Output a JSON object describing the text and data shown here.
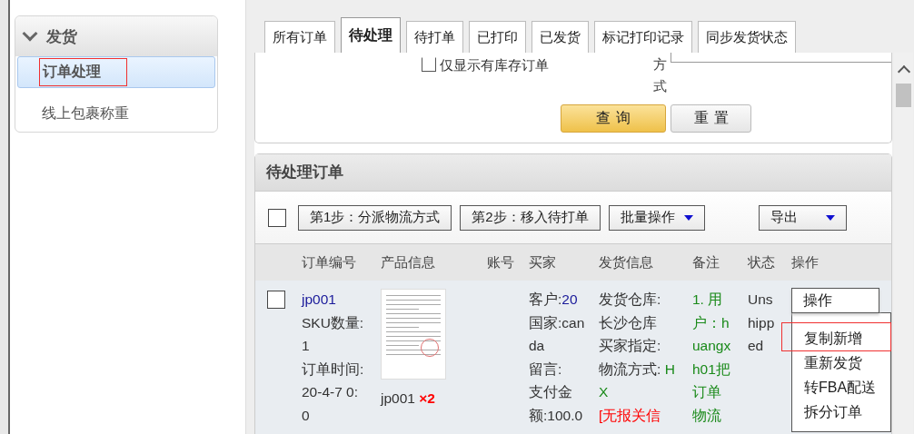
{
  "sidebar": {
    "title": "发货",
    "expanded": true,
    "items": [
      {
        "label": "订单处理",
        "selected": true,
        "highlighted": true
      },
      {
        "label": "线上包裹称重",
        "selected": false,
        "highlighted": false
      }
    ]
  },
  "tabs": [
    {
      "label": "所有订单",
      "selected": false
    },
    {
      "label": "待处理",
      "selected": true
    },
    {
      "label": "待打单",
      "selected": false
    },
    {
      "label": "已打印",
      "selected": false
    },
    {
      "label": "已发货",
      "selected": false
    },
    {
      "label": "标记打印记录",
      "selected": false
    },
    {
      "label": "同步发货状态",
      "selected": false
    }
  ],
  "filter": {
    "stock_only": {
      "label": "仅显示有库存订单",
      "checked": false
    },
    "select_label": "方式",
    "buttons": [
      {
        "label": "查询",
        "kind": "primary"
      },
      {
        "label": "重置",
        "kind": "default"
      }
    ]
  },
  "orders": {
    "title": "待处理订单",
    "select_all": false,
    "toolbar": [
      {
        "label": "第1步：分派物流方式",
        "kind": "button"
      },
      {
        "label": "第2步：移入待打单",
        "kind": "button"
      },
      {
        "label": "批量操作",
        "kind": "dropdown"
      },
      {
        "label": "导出",
        "kind": "dropdown"
      }
    ],
    "columns": [
      "订单编号",
      "产品信息",
      "账号",
      "买家",
      "发货信息",
      "备注",
      "状态",
      "操作"
    ],
    "rows": [
      {
        "selected": false,
        "order": [
          [
            {
              "text": "jp001",
              "kind": "link"
            }
          ],
          [
            {
              "text": "SKU数量:"
            }
          ],
          [
            {
              "text": "1"
            }
          ],
          [
            {
              "text": "订单时间:"
            }
          ],
          [
            {
              "text": "20-4-7 0:"
            }
          ],
          [
            {
              "text": "0"
            }
          ]
        ],
        "product": {
          "name": "jp001",
          "quantity": "×2"
        },
        "buyer": [
          [
            {
              "text": "客户:"
            },
            {
              "text": "20",
              "kind": "link"
            }
          ],
          [
            {
              "text": "国家:can"
            }
          ],
          [
            {
              "text": "da"
            }
          ],
          [
            {
              "text": "留言:"
            }
          ],
          [
            {
              "text": "支付金"
            }
          ],
          [
            {
              "text": "额:100.0"
            }
          ]
        ],
        "shipping": [
          [
            {
              "text": "发货仓库:"
            }
          ],
          [
            {
              "text": "长沙仓库"
            }
          ],
          [
            {
              "text": "买家指定:"
            }
          ],
          [
            {
              "text": "物流方式: "
            },
            {
              "text": "H",
              "kind": "positive"
            }
          ],
          [
            {
              "text": "X",
              "kind": "positive"
            }
          ],
          [
            {
              "text": "[无报关信",
              "kind": "warning"
            }
          ]
        ],
        "remarks": [
          [
            {
              "text": "1. 用",
              "kind": "positive"
            }
          ],
          [
            {
              "text": "户：h",
              "kind": "positive"
            }
          ],
          [
            {
              "text": "uangx",
              "kind": "positive"
            }
          ],
          [
            {
              "text": "h01把",
              "kind": "positive"
            }
          ],
          [
            {
              "text": "订单",
              "kind": "positive"
            }
          ],
          [
            {
              "text": "物流",
              "kind": "positive"
            }
          ]
        ],
        "status": [
          [
            {
              "text": "Uns"
            }
          ],
          [
            {
              "text": "hipp"
            }
          ],
          [
            {
              "text": "ed"
            }
          ]
        ],
        "actions": {
          "button": "操作",
          "items": [
            {
              "label": "复制新增",
              "highlighted": true
            },
            {
              "label": "重新发货",
              "highlighted": false
            },
            {
              "label": "转FBA配送",
              "highlighted": false
            },
            {
              "label": "拆分订单",
              "highlighted": false
            }
          ]
        }
      }
    ]
  }
}
